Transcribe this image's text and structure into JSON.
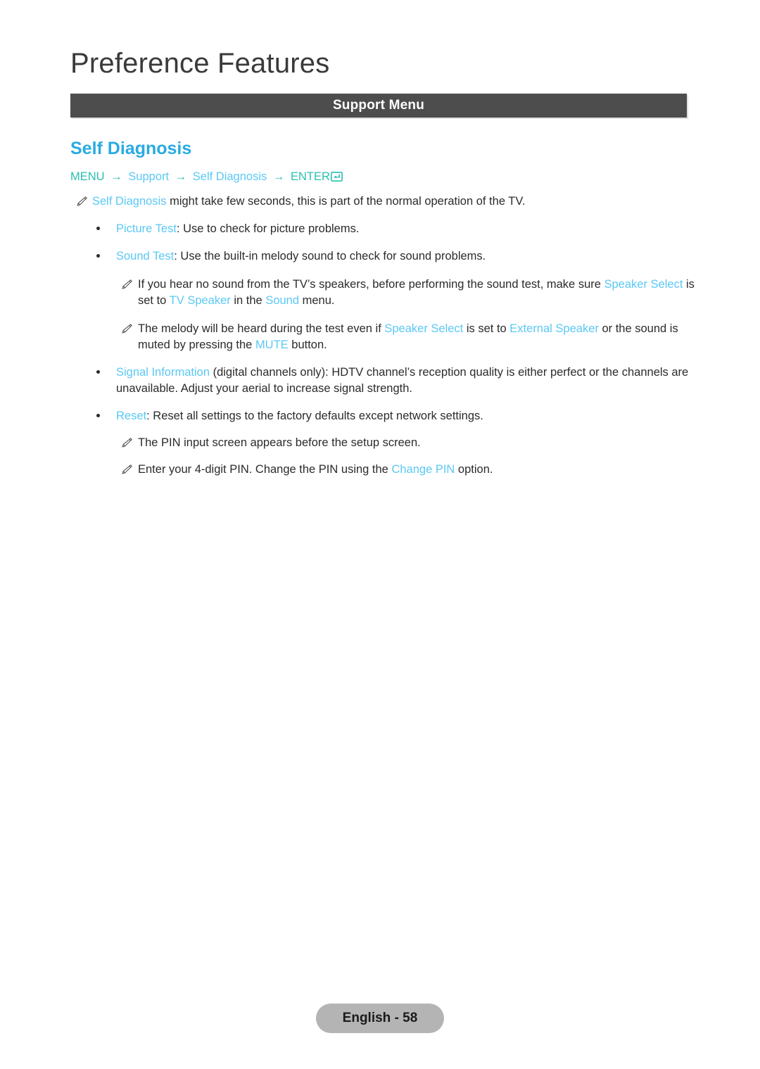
{
  "header": {
    "page_title": "Preference Features",
    "section_bar_label": "Support Menu",
    "section_bar_color": "#4d4d4d"
  },
  "colors": {
    "heading_blue": "#29ABE2",
    "highlight_blue": "#5bc8f5",
    "menu_teal": "#2cbfb2",
    "body_text": "#2b2b2b",
    "badge_bg": "#b4b4b4"
  },
  "topic": {
    "title": "Self Diagnosis",
    "menu_path": {
      "step1": "MENU",
      "step2": "Support",
      "step3": "Self Diagnosis",
      "step4": "ENTER",
      "arrow": "→",
      "enter_icon_name": "enter-return-icon"
    }
  },
  "notes": {
    "intro": {
      "highlight": "Self Diagnosis",
      "rest": " might take few seconds, this is part of the normal operation of the TV."
    },
    "sound_note_1": {
      "part1": "If you hear no sound from the TV’s speakers, before performing the sound test, make sure ",
      "hl1": "Speaker Select",
      "part2": " is set to ",
      "hl2": "TV Speaker",
      "part3": " in the ",
      "hl3": "Sound",
      "part4": " menu."
    },
    "sound_note_2": {
      "part1": "The melody will be heard during the test even if ",
      "hl1": "Speaker Select",
      "part2": " is set to ",
      "hl2": "External Speaker",
      "part3": " or the sound is muted by pressing the ",
      "hl3": "MUTE",
      "part4": " button."
    },
    "pin_note_1": {
      "text": "The PIN input screen appears before the setup screen."
    },
    "pin_note_2": {
      "part1": "Enter your 4-digit PIN. Change the PIN using the ",
      "hl1": "Change PIN",
      "part2": " option."
    }
  },
  "bullets": {
    "picture_test": {
      "label": "Picture Test",
      "text": ": Use to check for picture problems."
    },
    "sound_test": {
      "label": "Sound Test",
      "text": ": Use the built-in melody sound to check for sound problems."
    },
    "signal_information": {
      "label": "Signal Information",
      "text": " (digital channels only): HDTV channel’s reception quality is either perfect or the channels are unavailable. Adjust your aerial to increase signal strength."
    },
    "reset": {
      "label": "Reset",
      "text": ": Reset all settings to the factory defaults except network settings."
    }
  },
  "footer": {
    "page_label": "English - 58"
  }
}
